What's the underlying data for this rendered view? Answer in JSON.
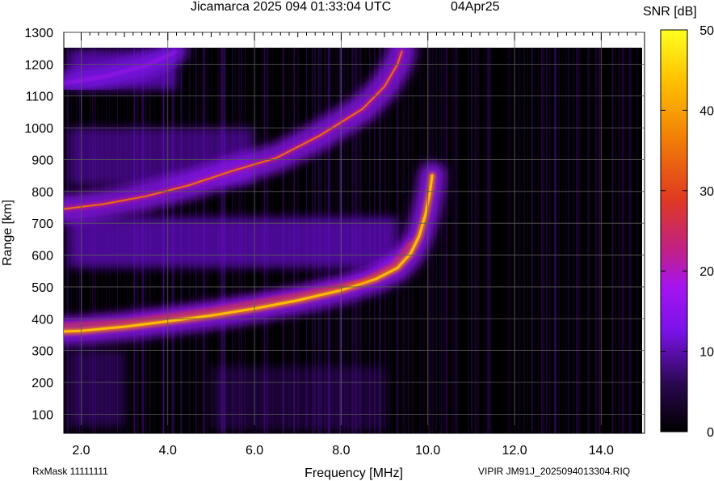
{
  "header": {
    "title": "Jicamarca 2025 094 01:33:04 UTC",
    "date": "04Apr25"
  },
  "footer": {
    "rxmask": "RxMask 11111111",
    "filename": "VIPIR  JM91J_2025094013304.RIQ"
  },
  "colors": {
    "background": "#000000",
    "grid": "#5a5a5a",
    "colormap": [
      "#000000",
      "#3a0a6a",
      "#7a12e8",
      "#a514f0",
      "#c8206a",
      "#e84018",
      "#f88a05",
      "#ffd200",
      "#ffff20"
    ]
  },
  "chart_data": {
    "type": "heatmap",
    "title": "Jicamarca 2025 094 01:33:04 UTC",
    "xlabel": "Frequency [MHz]",
    "ylabel": "Range [km]",
    "xlim": [
      1.6,
      15.0
    ],
    "ylim": [
      40,
      1300
    ],
    "x_ticks": [
      "2.0",
      "4.0",
      "6.0",
      "8.0",
      "10.0",
      "12.0",
      "14.0"
    ],
    "y_ticks": [
      "100",
      "200",
      "300",
      "400",
      "500",
      "600",
      "700",
      "800",
      "900",
      "1000",
      "1100",
      "1200",
      "1300"
    ],
    "grid": true,
    "colorbar": {
      "label": "SNR [dB]",
      "range": [
        0,
        50
      ],
      "ticks": [
        "0",
        "10",
        "20",
        "30",
        "40",
        "50"
      ]
    },
    "traces": [
      {
        "name": "",
        "points": [
          [
            1.6,
            360
          ],
          [
            2.0,
            362
          ],
          [
            3.0,
            375
          ],
          [
            4.0,
            392
          ],
          [
            5.0,
            410
          ],
          [
            6.0,
            432
          ],
          [
            7.0,
            458
          ],
          [
            8.0,
            490
          ],
          [
            8.8,
            525
          ],
          [
            9.3,
            560
          ],
          [
            9.6,
            605
          ],
          [
            9.8,
            660
          ],
          [
            9.95,
            730
          ],
          [
            10.05,
            800
          ],
          [
            10.1,
            850
          ]
        ]
      },
      {
        "name": "",
        "points": [
          [
            1.6,
            380
          ],
          [
            3.0,
            392
          ],
          [
            5.0,
            428
          ],
          [
            7.0,
            476
          ],
          [
            8.5,
            520
          ],
          [
            9.2,
            570
          ],
          [
            9.6,
            640
          ]
        ]
      },
      {
        "name": "",
        "points": [
          [
            1.6,
            745
          ],
          [
            2.5,
            760
          ],
          [
            3.5,
            785
          ],
          [
            4.5,
            820
          ],
          [
            5.5,
            865
          ],
          [
            6.5,
            905
          ],
          [
            7.5,
            975
          ],
          [
            8.5,
            1060
          ],
          [
            9.0,
            1130
          ],
          [
            9.3,
            1200
          ],
          [
            9.4,
            1240
          ]
        ]
      },
      {
        "name": "",
        "points": [
          [
            1.6,
            1140
          ],
          [
            2.5,
            1160
          ],
          [
            3.5,
            1195
          ],
          [
            4.2,
            1240
          ]
        ]
      }
    ]
  }
}
